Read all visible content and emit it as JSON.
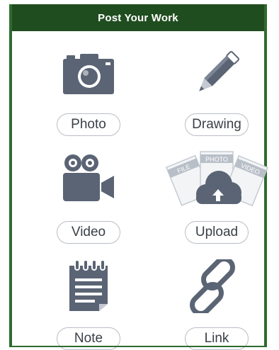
{
  "header": {
    "title": "Post Your Work"
  },
  "tiles": [
    {
      "label": "Photo",
      "icon": "camera-icon"
    },
    {
      "label": "Drawing",
      "icon": "pencil-icon"
    },
    {
      "label": "Video",
      "icon": "video-camera-icon"
    },
    {
      "label": "Upload",
      "icon": "cloud-upload-icon",
      "card_labels": [
        "FILE",
        "PHOTO",
        "VIDEO"
      ]
    },
    {
      "label": "Note",
      "icon": "notepad-icon"
    },
    {
      "label": "Link",
      "icon": "link-icon"
    }
  ],
  "colors": {
    "header_bg": "#204d1f",
    "frame_border": "#2f6b2f",
    "icon": "#5a6474",
    "pill_border": "#b9bec6"
  }
}
